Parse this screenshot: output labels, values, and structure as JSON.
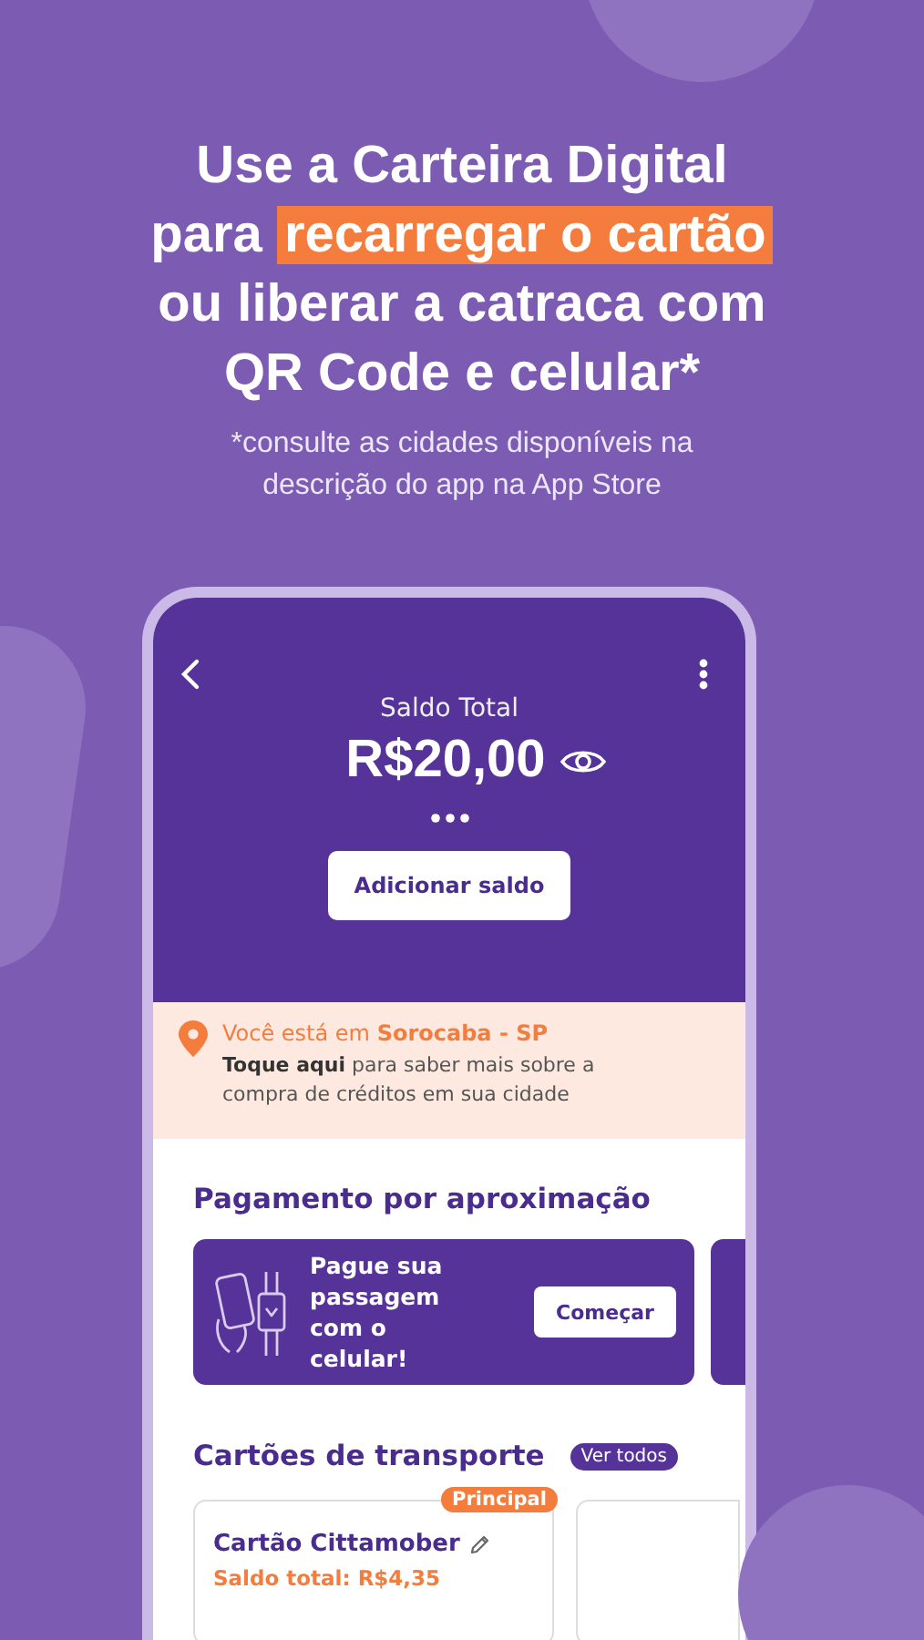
{
  "headline": [
    [
      {
        "text": "Use a Carteira Digital",
        "highlight": false
      }
    ],
    [
      {
        "text": "para ",
        "highlight": false
      },
      {
        "text": "recarregar o cartão",
        "highlight": true
      }
    ],
    [
      {
        "text": "ou liberar a catraca com",
        "highlight": false
      }
    ],
    [
      {
        "text": "QR Code e celular*",
        "highlight": false
      }
    ]
  ],
  "subtitle": [
    "*consulte as cidades disponíveis na",
    "descrição do app na App Store"
  ],
  "phone": {
    "balance_label": "Saldo Total",
    "balance": "R$20,00",
    "add_button": "Adicionar saldo",
    "location": {
      "prefix": "Você está em ",
      "city": "Sorocaba - SP",
      "info": "**Toque aqui** para saber mais sobre a compra de créditos em sua cidade"
    },
    "payment": {
      "title": "Pagamento por aproximação",
      "card_text": "Pague sua passagem com o celular!",
      "card_button": "Começar"
    },
    "cards": {
      "title": "Cartões de transporte",
      "see_all": "Ver todos",
      "items": [
        {
          "badge": "Principal",
          "name": "Cartão Cittamober",
          "balance": "Saldo total: R$4,35"
        }
      ]
    }
  }
}
